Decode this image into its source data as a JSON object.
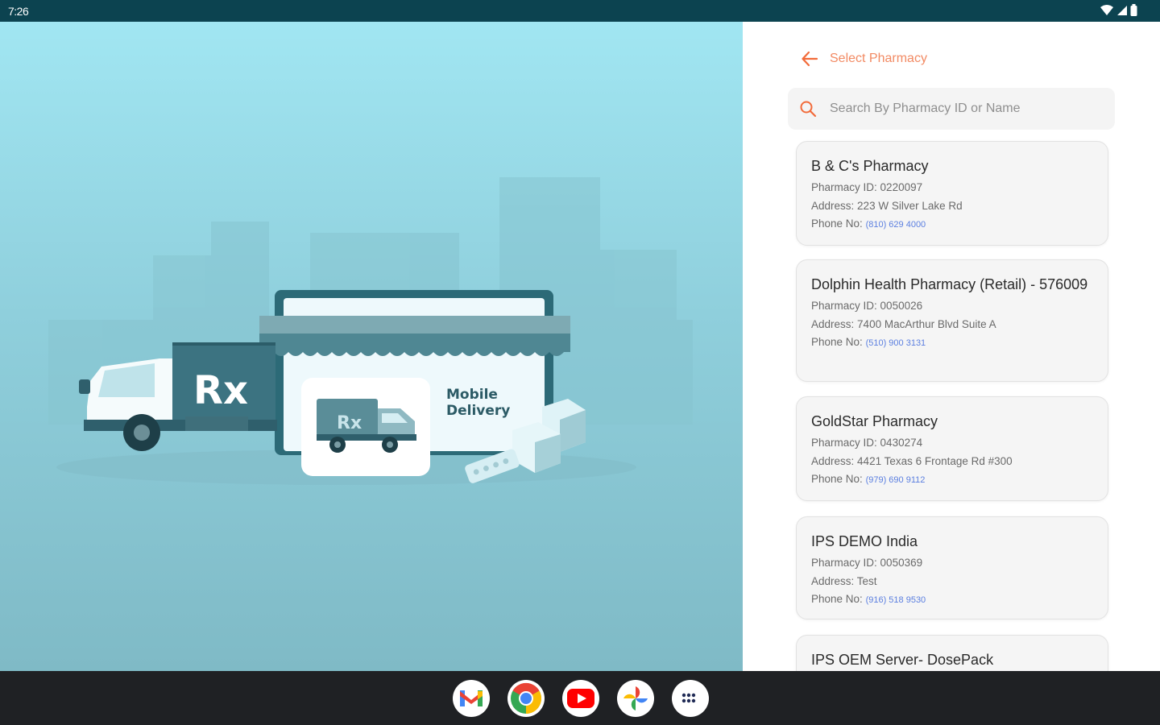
{
  "status_bar": {
    "time": "7:26"
  },
  "hero": {
    "truck_label": "Rx",
    "small_truck_label": "Rx",
    "store_line1": "Mobile",
    "store_line2": "Delivery"
  },
  "header": {
    "title": "Select Pharmacy"
  },
  "search": {
    "placeholder": "Search By Pharmacy ID or Name"
  },
  "labels": {
    "pharmacy_id": "Pharmacy ID:",
    "address": "Address:",
    "phone": "Phone No:"
  },
  "pharmacies": [
    {
      "name": "B & C's Pharmacy",
      "id": "0220097",
      "address": "223 W Silver Lake Rd",
      "phone": "(810) 629 4000"
    },
    {
      "name": "Dolphin Health Pharmacy (Retail) - 576009",
      "id": "0050026",
      "address": "7400 MacArthur Blvd Suite A",
      "phone": "(510) 900 3131"
    },
    {
      "name": "GoldStar Pharmacy",
      "id": "0430274",
      "address": "4421 Texas 6 Frontage Rd #300",
      "phone": "(979) 690 9112"
    },
    {
      "name": "IPS DEMO India",
      "id": "0050369",
      "address": "Test",
      "phone": "(916) 518 9530"
    },
    {
      "name": "IPS OEM Server- DosePack"
    }
  ],
  "taskbar": {
    "apps": [
      "Gmail",
      "Chrome",
      "YouTube",
      "Photos",
      "App launcher"
    ]
  },
  "colors": {
    "accent": "#f26b3a",
    "status_bar": "#0c4350",
    "phone_link": "#5b7fe0"
  }
}
